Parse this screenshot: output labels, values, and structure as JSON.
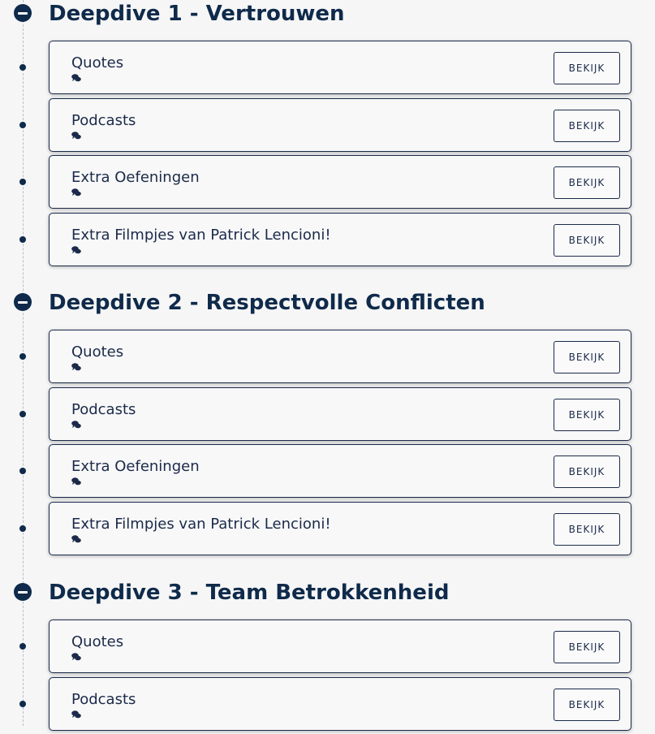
{
  "sections": [
    {
      "title": "Deepdive 1 - Vertrouwen",
      "items": [
        {
          "title": "Quotes",
          "button": "BEKIJK"
        },
        {
          "title": "Podcasts",
          "button": "BEKIJK"
        },
        {
          "title": "Extra Oefeningen",
          "button": "BEKIJK"
        },
        {
          "title": "Extra Filmpjes van Patrick Lencioni!",
          "button": "BEKIJK"
        }
      ]
    },
    {
      "title": "Deepdive 2 - Respectvolle Conflicten",
      "items": [
        {
          "title": "Quotes",
          "button": "BEKIJK"
        },
        {
          "title": "Podcasts",
          "button": "BEKIJK"
        },
        {
          "title": "Extra Oefeningen",
          "button": "BEKIJK"
        },
        {
          "title": "Extra Filmpjes van Patrick Lencioni!",
          "button": "BEKIJK"
        }
      ]
    },
    {
      "title": "Deepdive 3 - Team Betrokkenheid",
      "items": [
        {
          "title": "Quotes",
          "button": "BEKIJK"
        },
        {
          "title": "Podcasts",
          "button": "BEKIJK"
        }
      ]
    }
  ],
  "icons": {
    "collapse": "minus-circle-icon",
    "comment": "comments-icon"
  },
  "colors": {
    "primary": "#0f2a4a",
    "background": "#f6f6f7",
    "card": "#f8f8f8"
  }
}
